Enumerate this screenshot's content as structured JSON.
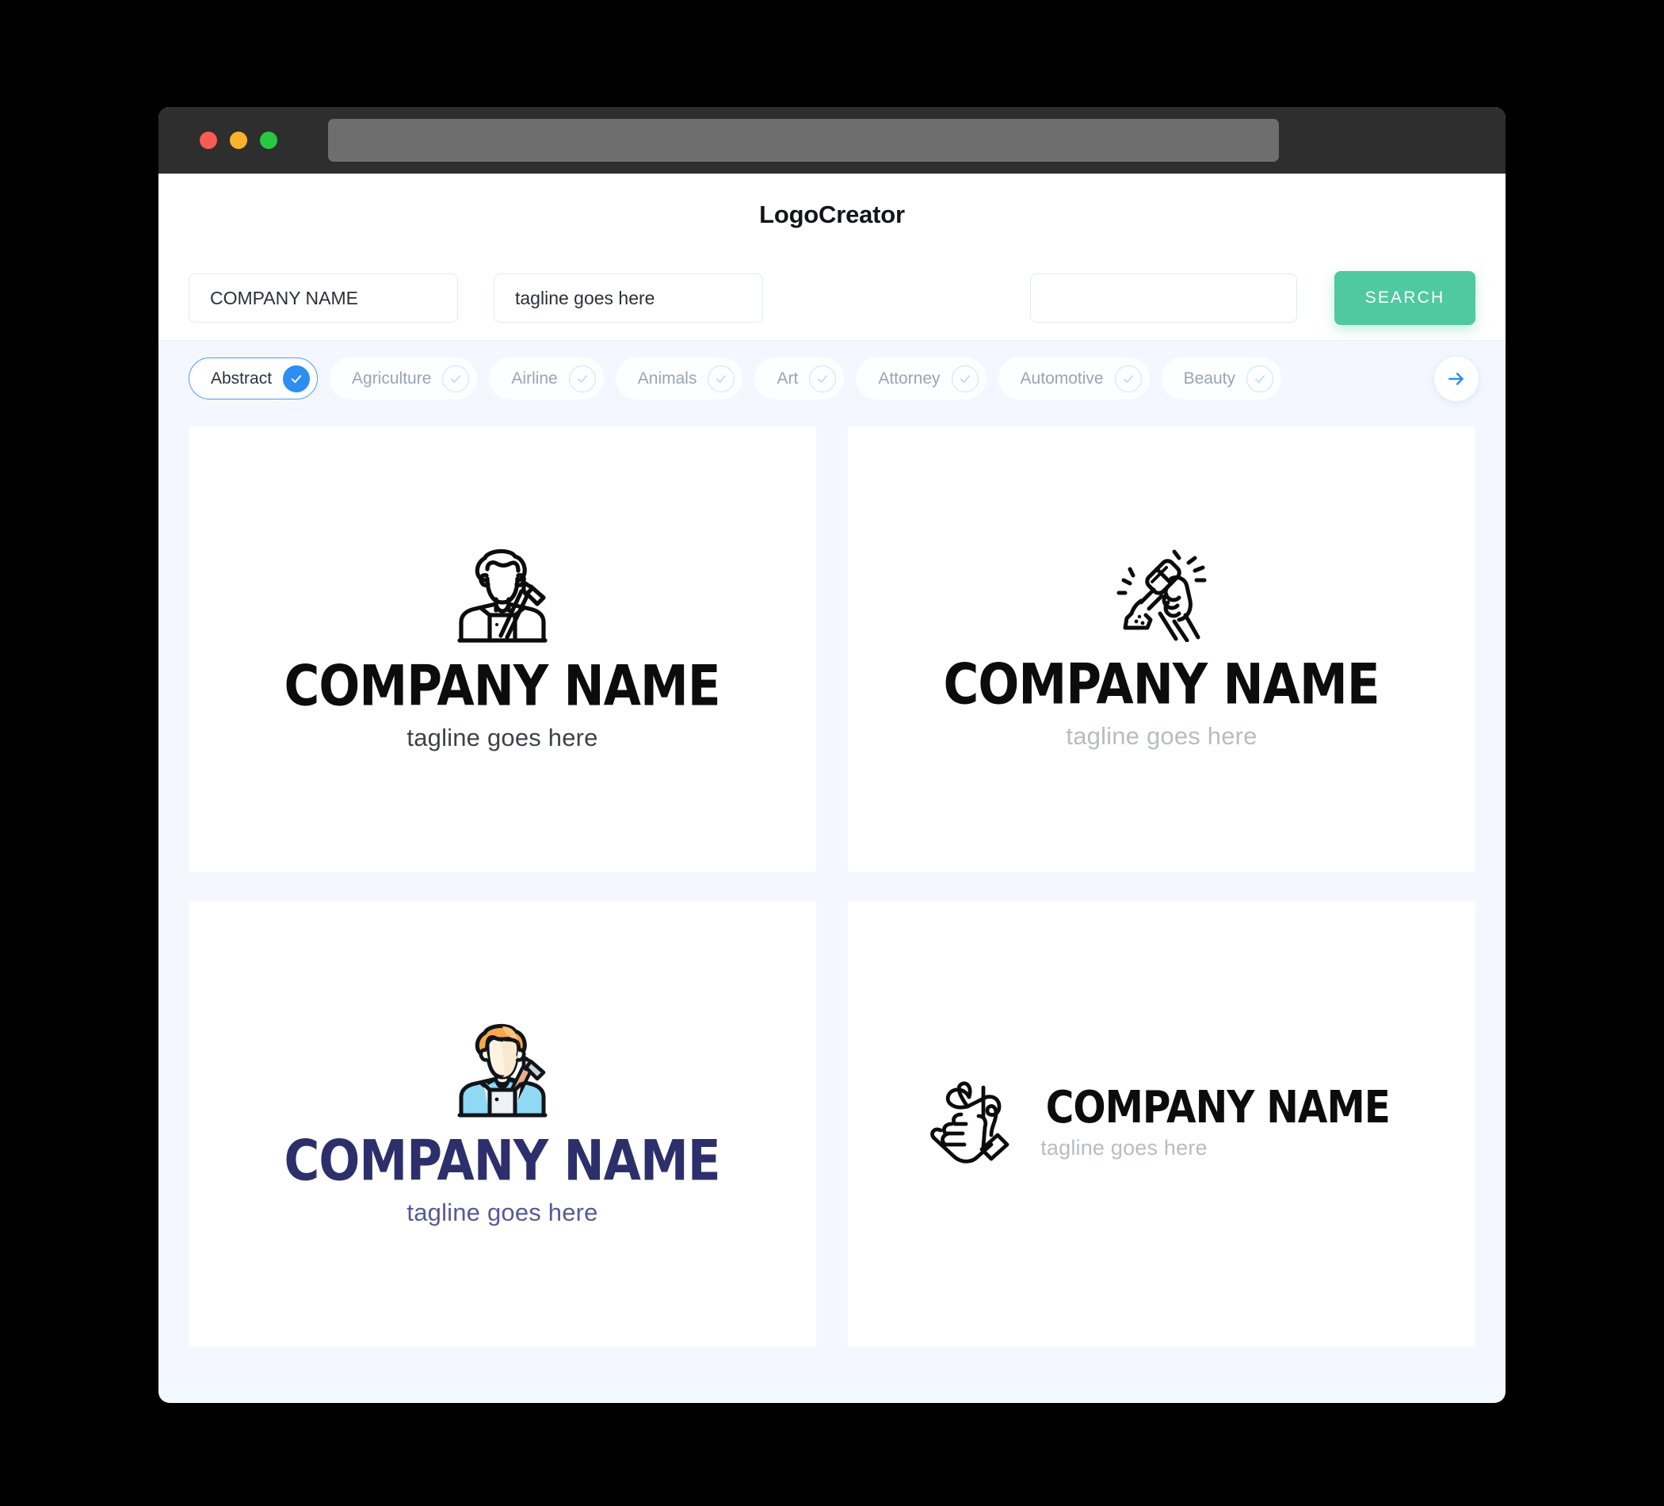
{
  "window": {
    "traffic_lights": [
      {
        "name": "close",
        "color": "#f85b52"
      },
      {
        "name": "minimize",
        "color": "#f8b32b"
      },
      {
        "name": "maximize",
        "color": "#28c840"
      }
    ],
    "url_value": ""
  },
  "header": {
    "brand_title": "LogoCreator"
  },
  "search": {
    "company_name_value": "COMPANY NAME",
    "company_name_placeholder": "COMPANY NAME",
    "tagline_value": "tagline goes here",
    "tagline_placeholder": "tagline goes here",
    "keyword_value": "",
    "keyword_placeholder": "",
    "search_label": "SEARCH",
    "search_button_color": "#50c9a0"
  },
  "categories": {
    "items": [
      {
        "label": "Abstract",
        "selected": true
      },
      {
        "label": "Agriculture",
        "selected": false
      },
      {
        "label": "Airline",
        "selected": false
      },
      {
        "label": "Animals",
        "selected": false
      },
      {
        "label": "Art",
        "selected": false
      },
      {
        "label": "Attorney",
        "selected": false
      },
      {
        "label": "Automotive",
        "selected": false
      },
      {
        "label": "Beauty",
        "selected": false
      }
    ],
    "next_icon": "arrow-right-icon",
    "selected_accent": "#2b8ef0"
  },
  "results": {
    "cards": [
      {
        "icon_name": "worker-with-hammer-outline-icon",
        "layout": "stacked",
        "company": "COMPANY NAME",
        "tagline": "tagline goes here",
        "scheme": "black"
      },
      {
        "icon_name": "jackhammer-hands-outline-icon",
        "layout": "stacked",
        "company": "COMPANY NAME",
        "tagline": "tagline goes here",
        "scheme": "grey"
      },
      {
        "icon_name": "worker-with-hammer-color-icon",
        "layout": "stacked",
        "company": "COMPANY NAME",
        "tagline": "tagline goes here",
        "scheme": "navy",
        "colors": {
          "hair": "#f8a84c",
          "hair_light": "#fbc37d",
          "skin": "#fdf3e3",
          "shirt": "#8fd9f5",
          "shirt_light": "#a8e1f8",
          "overalls": "#eef2f6",
          "hammer_handle": "#e8b08a",
          "hammer_head": "#ccd3da",
          "outline": "#111418"
        }
      },
      {
        "icon_name": "hand-needle-heart-outline-icon",
        "layout": "horizontal",
        "company": "COMPANY NAME",
        "tagline": "tagline goes here",
        "scheme": "grey"
      }
    ]
  }
}
